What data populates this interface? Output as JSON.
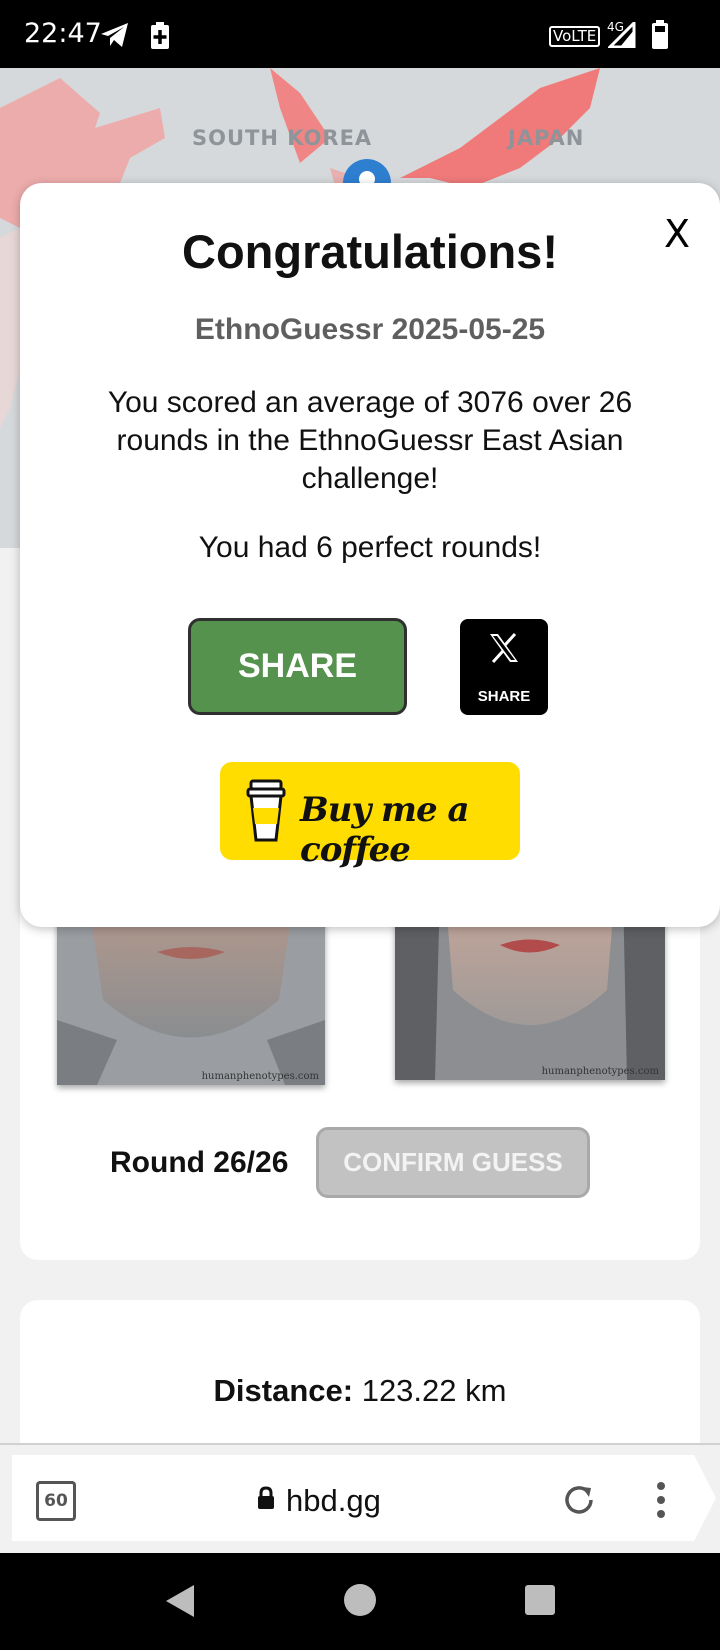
{
  "status_bar": {
    "time": "22:47",
    "icons": [
      "telegram-icon",
      "battery-saver-icon",
      "volte-icon",
      "signal-4g-icon",
      "battery-icon"
    ],
    "volte_label": "VoLTE",
    "network_label": "4G"
  },
  "map": {
    "labels": [
      "SOUTH KOREA",
      "JAPAN"
    ],
    "marker": "map-pin-icon"
  },
  "modal": {
    "close_label": "X",
    "title": "Congratulations!",
    "subtitle": "EthnoGuessr 2025-05-25",
    "score_text": "You scored an average of 3076 over 26 rounds in the EthnoGuessr East Asian challenge!",
    "perfect_text": "You had 6 perfect rounds!",
    "share_label": "SHARE",
    "x_share_label": "SHARE",
    "coffee_label": "Buy me a coffee",
    "colors": {
      "share": "#54924d",
      "coffee": "#ffdd00",
      "x": "#000000"
    }
  },
  "game": {
    "face_watermark_left": "humanphenotypes.com",
    "face_watermark_right": "humanphenotypes.com",
    "round_label": "Round 26/26",
    "confirm_label": "CONFIRM GUESS",
    "distance_label": "Distance:",
    "distance_value": "123.22 km"
  },
  "browser": {
    "tab_count": "60",
    "url": "hbd.gg",
    "icons": [
      "lock-icon",
      "reload-icon",
      "more-menu-icon"
    ]
  },
  "nav": {
    "icons": [
      "back-icon",
      "home-icon",
      "recents-icon"
    ]
  }
}
